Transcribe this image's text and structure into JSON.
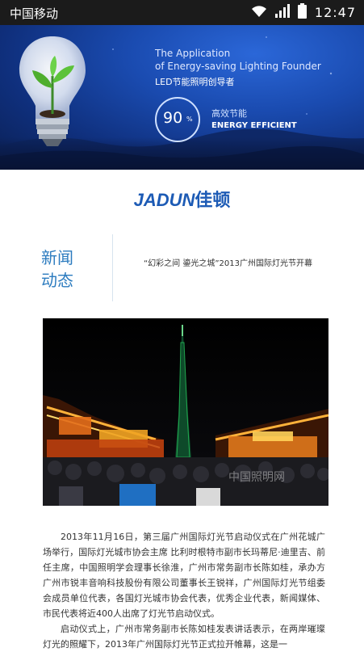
{
  "status_bar": {
    "carrier": "中国移动",
    "time": "12:47",
    "icons": [
      "wifi-icon",
      "signal-icon",
      "battery-icon"
    ]
  },
  "banner": {
    "title_line1": "The Application",
    "title_line2": "of Energy-saving Lighting Founder",
    "title_line3": "LED节能照明创导者",
    "percent_value": "90",
    "percent_sign": "%",
    "efficiency_cn": "高效节能",
    "efficiency_en": "ENERGY EFFICIENT"
  },
  "logo": {
    "en": "JADUN",
    "cn": "佳顿"
  },
  "section": {
    "title_line1": "新闻",
    "title_line2": "动态",
    "headline": "“幻彩之间 鎏光之城”2013广州国际灯光节开幕"
  },
  "photo": {
    "watermark": "中国照明网"
  },
  "article": {
    "paragraph1": "2013年11月16日，第三届广州国际灯光节启动仪式在广州花城广场举行，国际灯光城市协会主席 比利时根特市副市长玛蒂尼·迪里吉、前任主席，中国照明学会理事长徐淮，广州市常务副市长陈如桂，承办方广州市锐丰音响科技股份有限公司董事长王锐祥，广州国际灯光节组委会成员单位代表，各国灯光城市协会代表，优秀企业代表，新闻媒体、市民代表将近400人出席了灯光节启动仪式。",
    "paragraph2": "启动仪式上，广州市常务副市长陈如桂发表讲话表示，在两岸璀璨灯光的照耀下，2013年广州国际灯光节正式拉开帷幕，这是一"
  },
  "colors": {
    "accent": "#2b7bbf",
    "logo": "#1d5bb5",
    "status_bar": "#1b1b1b"
  }
}
